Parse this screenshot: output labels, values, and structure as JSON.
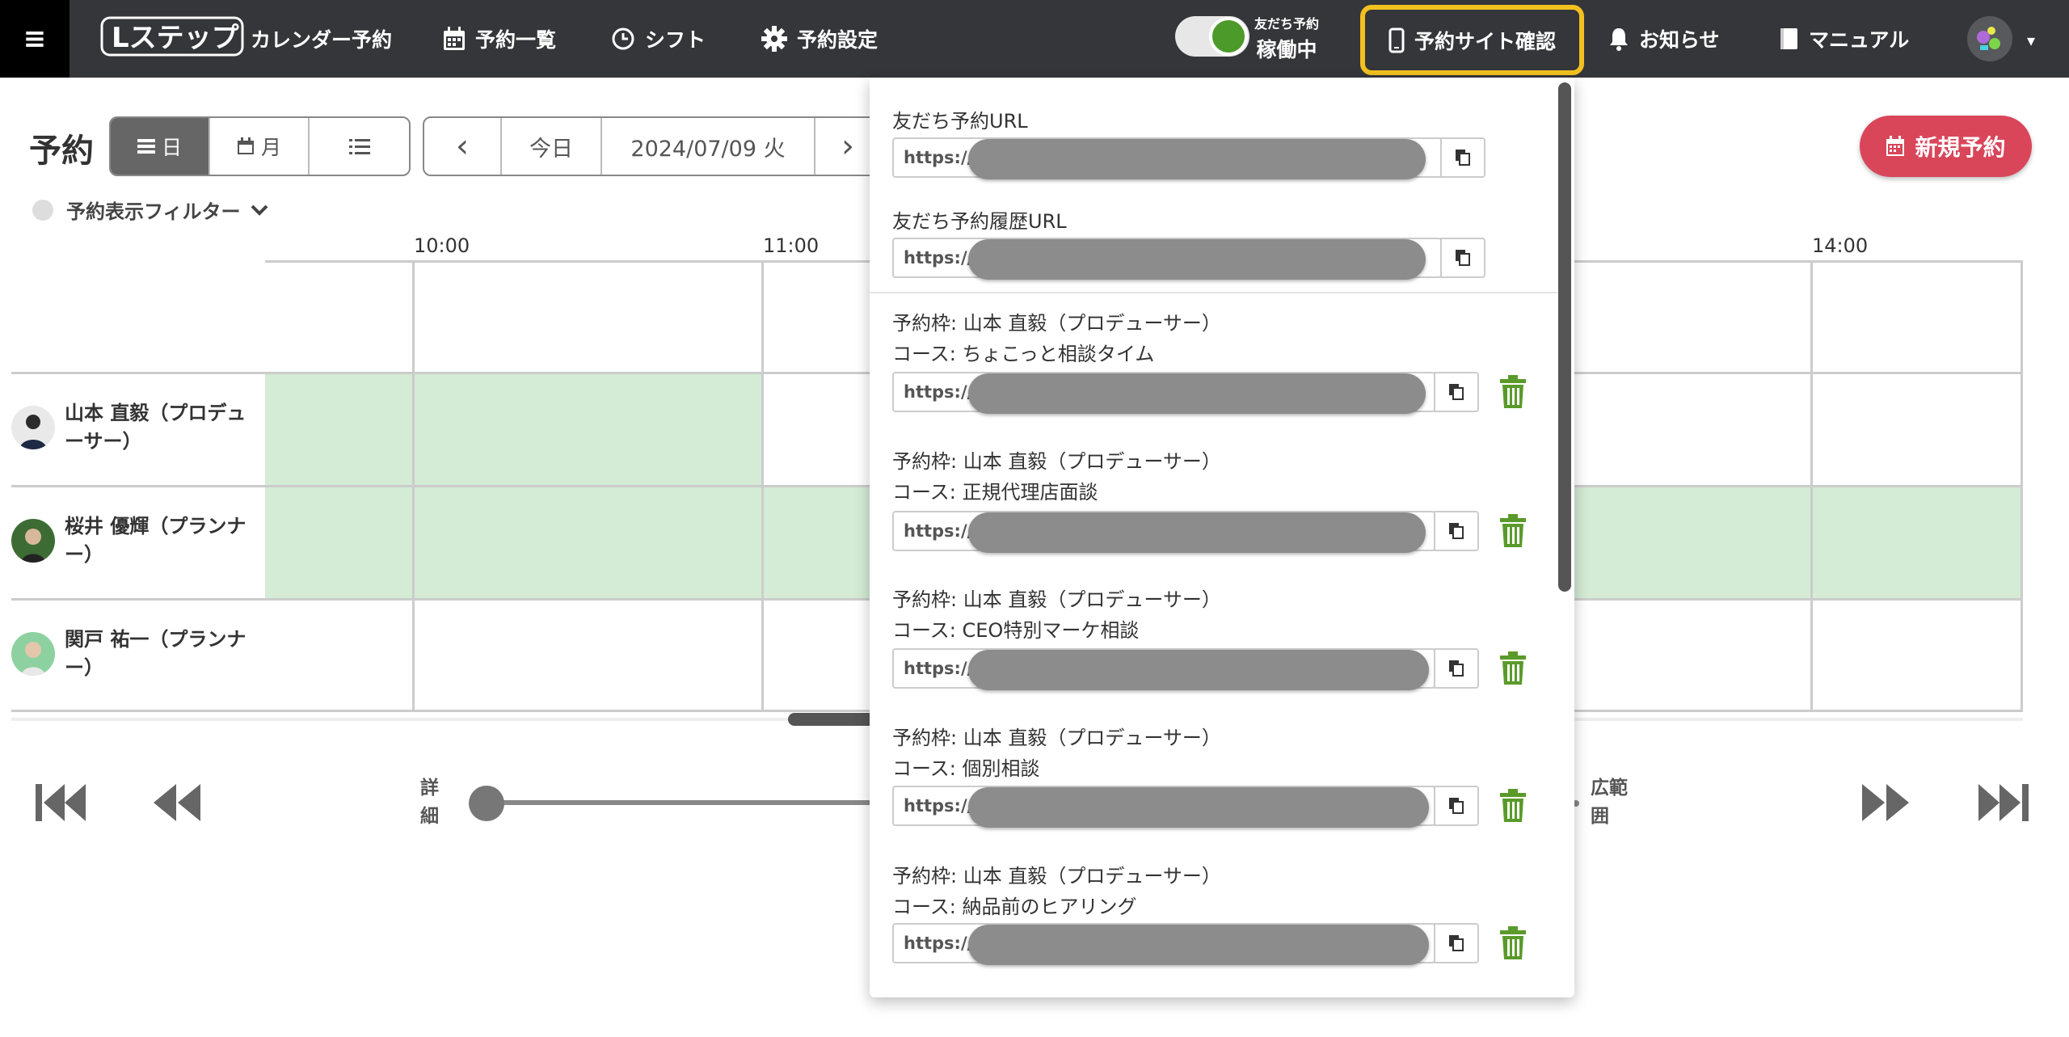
{
  "header": {
    "menu_icon": "≡",
    "brand_label": "カレンダー予約",
    "nav": [
      {
        "label": "予約一覧",
        "icon": "calendar-icon"
      },
      {
        "label": "シフト",
        "icon": "clock-icon"
      },
      {
        "label": "予約設定",
        "icon": "gear-icon"
      }
    ],
    "toggle_small": "友だち予約",
    "toggle_big": "稼働中",
    "site_check_label": "予約サイト確認",
    "notice_label": "お知らせ",
    "manual_label": "マニュアル"
  },
  "toolbar": {
    "title": "予約",
    "view_day": "日",
    "view_month": "月",
    "today_label": "今日",
    "date_value": "2024/07/09 火",
    "prev": "‹",
    "next": "›",
    "new_reservation": "新規予約"
  },
  "filter_label": "予約表示フィルター",
  "timeline": {
    "times": [
      "10:00",
      "11:00",
      "14:00"
    ],
    "staff": [
      {
        "name": "山本 直毅（プロデュ\nーサー）"
      },
      {
        "name": "桜井 優輝（プランナ\nー）"
      },
      {
        "name": "関戸 祐一（プランナ\nー）"
      }
    ]
  },
  "zoom": {
    "detail_label": "詳\n細",
    "wide_label": "広範\n囲"
  },
  "dropdown": {
    "friend_url_label": "友だち予約URL",
    "friend_history_label": "友だち予約履歴URL",
    "url_prefix": "https://",
    "items": [
      {
        "frame": "予約枠: 山本 直毅（プロデューサー）",
        "course": "コース: ちょこっと相談タイム"
      },
      {
        "frame": "予約枠: 山本 直毅（プロデューサー）",
        "course": "コース: 正規代理店面談"
      },
      {
        "frame": "予約枠: 山本 直毅（プロデューサー）",
        "course": "コース: CEO特別マーケ相談"
      },
      {
        "frame": "予約枠: 山本 直毅（プロデューサー）",
        "course": "コース: 個別相談"
      },
      {
        "frame": "予約枠: 山本 直毅（プロデューサー）",
        "course": "コース: 納品前のヒアリング"
      }
    ]
  },
  "colors": {
    "topbar": "#35363a",
    "highlight": "#f2c11f",
    "toggle_on": "#4c9a2a",
    "new_button": "#d9465a",
    "available_slot": "#d4ebd5",
    "trash": "#5a9a2a"
  }
}
